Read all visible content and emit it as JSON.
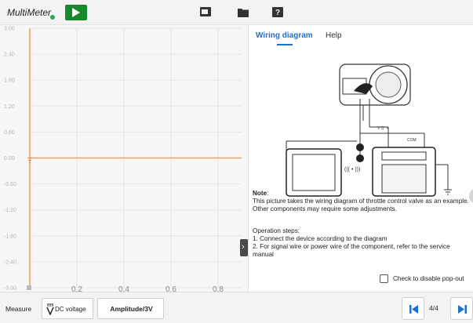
{
  "app": {
    "title": "MultiMeter"
  },
  "colors": {
    "accent": "#1f6fd1",
    "play": "#148a2a",
    "trace": "#f0a060",
    "axis": "#e58a2c",
    "status_dot": "#2ea84a"
  },
  "toolbar": {
    "icons": [
      "play-icon",
      "screenshot-icon",
      "folder-icon",
      "help-icon"
    ]
  },
  "chart_data": {
    "type": "line",
    "ylim": [
      -3.0,
      3.0
    ],
    "xlim": [
      0,
      0.9
    ],
    "y_ticks": [
      "3.00",
      "2.40",
      "1.80",
      "1.20",
      "0.60",
      "0.00",
      "-0.60",
      "-1.20",
      "-1.80",
      "-2.40",
      "-3.00"
    ],
    "x_ticks": [
      "0.2",
      "0.4",
      "0.6",
      "0.8"
    ],
    "grid": true,
    "series": [
      {
        "x": [
          0,
          0.9
        ],
        "y": [
          0.0,
          0.0
        ]
      }
    ]
  },
  "right_panel": {
    "tabs": [
      {
        "label": "Wiring diagram",
        "active": true
      },
      {
        "label": "Help",
        "active": false
      }
    ],
    "note_label": "Note",
    "note_text": "This picture takes the wiring diagram of throttle control valve as an example. Other components may require some adjustments.",
    "ops_title": "Operation steps:",
    "ops_steps": [
      "1. Connect the device according to the diagram",
      "2. For signal wire or power wire of the component, refer to the service manual"
    ],
    "checkbox_label": "Check to disable pop-out",
    "diagram_labels": {
      "v_ohm": "V Ω ➝",
      "com": "COM"
    }
  },
  "bottom": {
    "measure_label": "Measure",
    "mode_label": "DC voltage",
    "amplitude_label": "Amplitude/3V",
    "page_indicator": "4/4"
  }
}
